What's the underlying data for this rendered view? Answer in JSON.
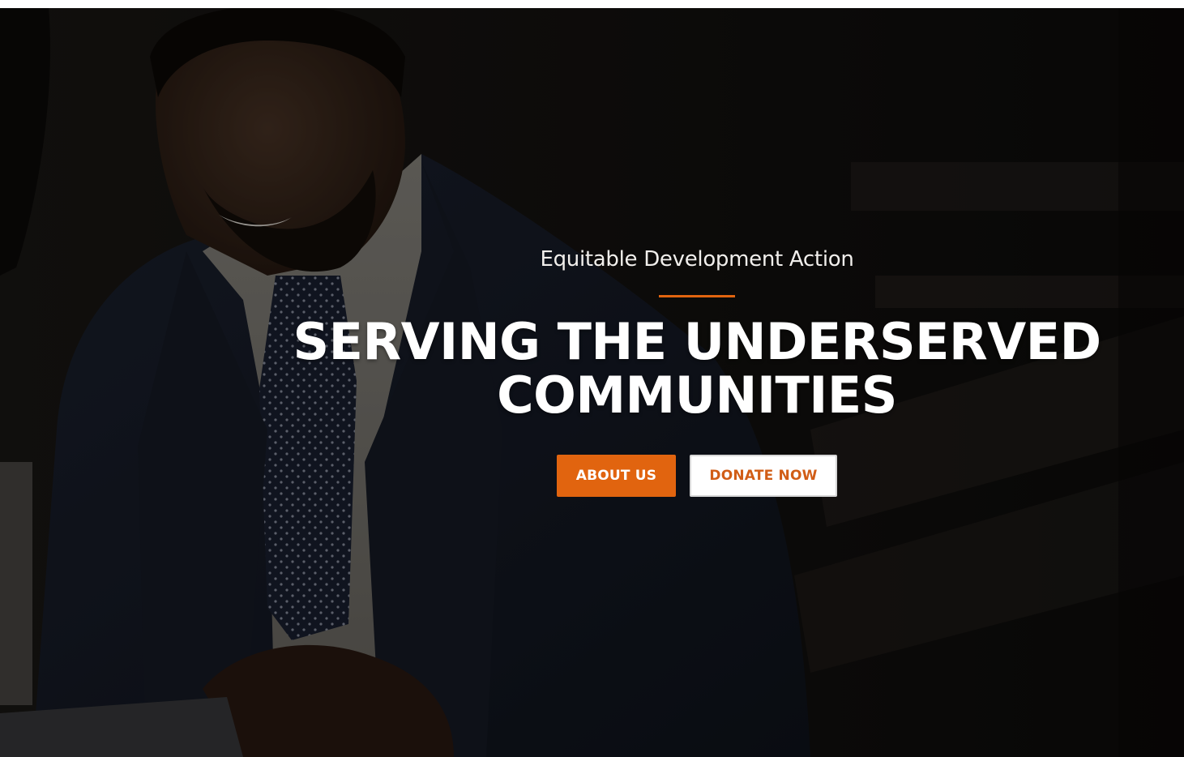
{
  "hero": {
    "eyebrow": "Equitable Development Action",
    "headline_line1": "SERVING THE UNDERSERVED",
    "headline_line2": "COMMUNITIES",
    "about_button": "ABOUT US",
    "donate_button": "DONATE NOW"
  },
  "colors": {
    "accent": "#e1640f",
    "headline": "#ffffff",
    "overlay": "#0b0a09"
  }
}
